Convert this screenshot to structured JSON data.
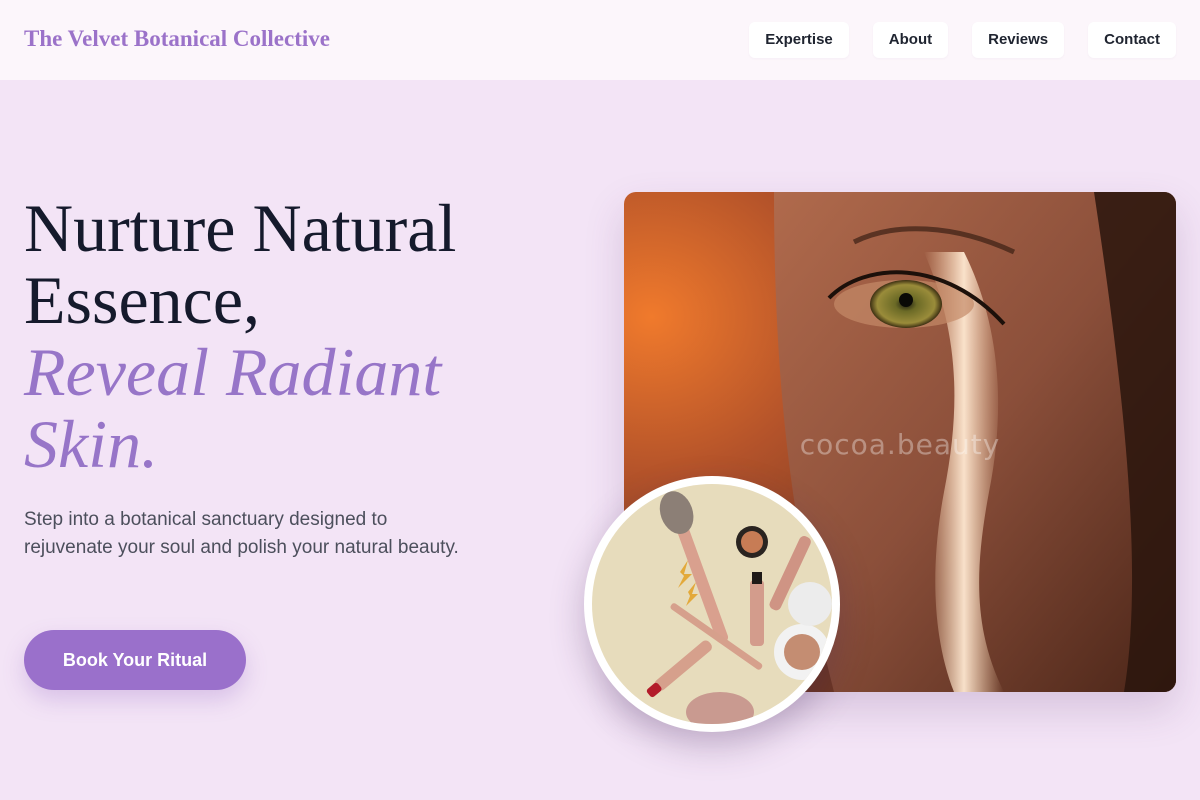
{
  "header": {
    "brand": "The Velvet Botanical Collective",
    "nav": [
      {
        "label": "Expertise"
      },
      {
        "label": "About"
      },
      {
        "label": "Reviews"
      },
      {
        "label": "Contact"
      }
    ]
  },
  "hero": {
    "title_line1": "Nurture Natural",
    "title_line2": "Essence,",
    "title_accent_line1": "Reveal Radiant",
    "title_accent_line2": "Skin.",
    "subtitle": "Step into a botanical sanctuary designed to rejuvenate your soul and polish your natural beauty.",
    "cta_label": "Book Your Ritual"
  },
  "images": {
    "main_watermark": "cocoa.beauty",
    "main_subject": "close-up portrait of eye with light beam",
    "inset_subject": "flat lay of makeup brushes and cosmetics"
  },
  "colors": {
    "background": "#f3e4f6",
    "header_bg": "#fcf6fb",
    "brand": "#9b72c9",
    "accent": "#9775c8",
    "heading": "#151a2c",
    "button": "#9a70cb"
  }
}
